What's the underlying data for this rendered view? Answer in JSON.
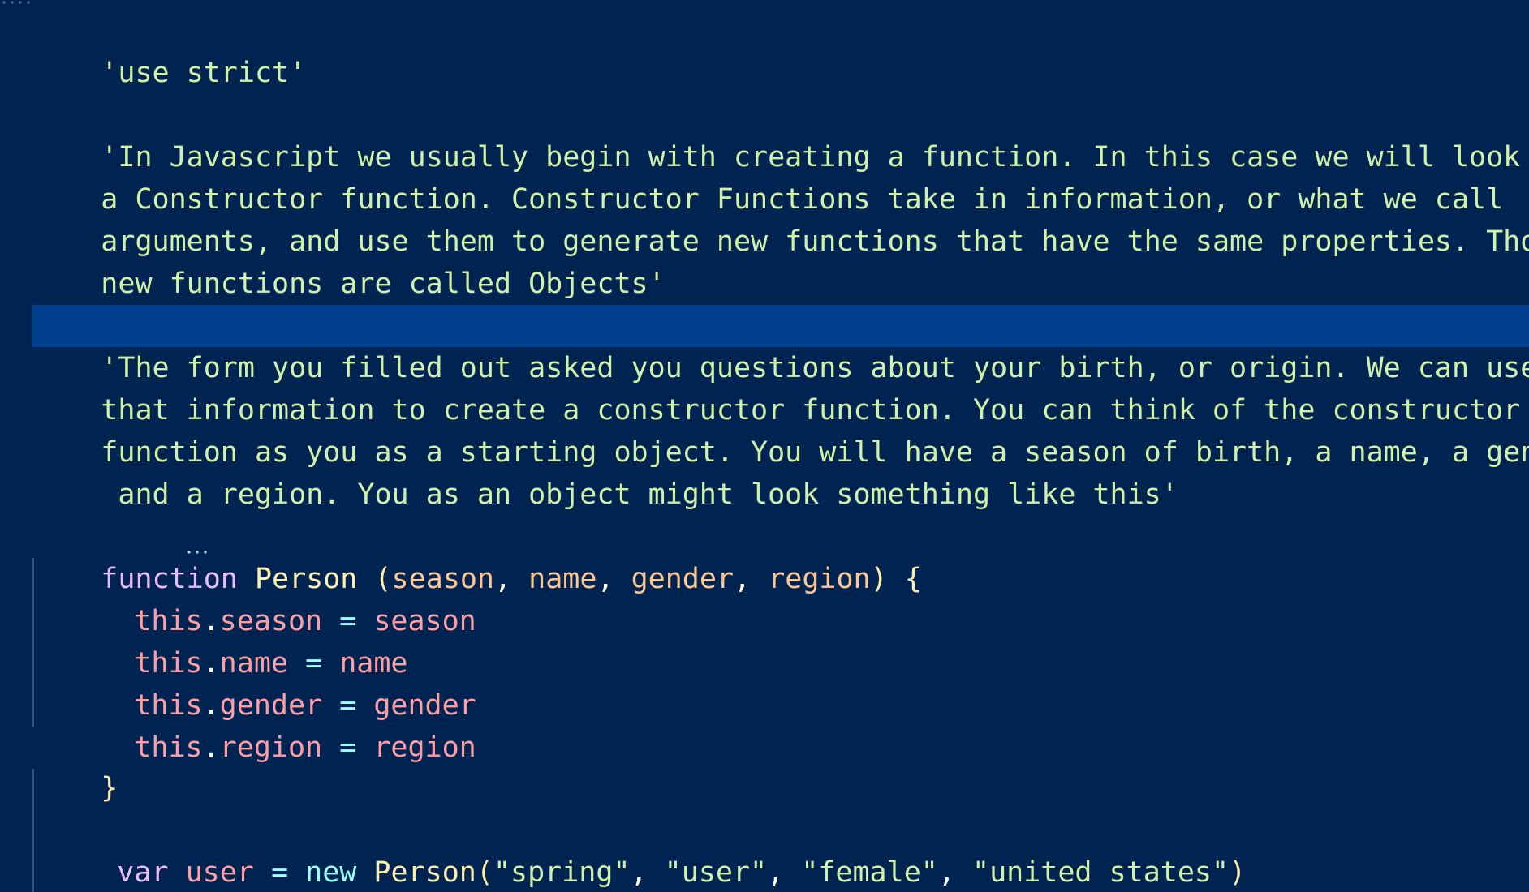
{
  "code": {
    "use_strict": "'use strict'",
    "comment1": [
      "'In Javascript we usually begin with creating a function. In this case we will look at",
      "a Constructor function. Constructor Functions take in information, or what we call",
      "arguments, and use them to generate new functions that have the same properties. Those",
      "new functions are called Objects'"
    ],
    "comment2": [
      "'The form you filled out asked you questions about your birth, or origin. We can use",
      "that information to create a constructor function. You can think of the constructor",
      "function as you as a starting object. You will have a season of birth, a name, a gender,",
      " and a region. You as an object might look something like this'"
    ],
    "func_decl": {
      "keyword": "function",
      "name": "Person",
      "open_paren": " (",
      "params": [
        "season",
        "name",
        "gender",
        "region"
      ],
      "close": ") {"
    },
    "body": [
      {
        "this": "this",
        "prop": "season",
        "eq": " = ",
        "val": "season"
      },
      {
        "this": "this",
        "prop": "name",
        "eq": " = ",
        "val": "name"
      },
      {
        "this": "this",
        "prop": "gender",
        "eq": " = ",
        "val": "gender"
      },
      {
        "this": "this",
        "prop": "region",
        "eq": " = ",
        "val": "region"
      }
    ],
    "close_brace": "}",
    "var_line": {
      "keyword": "var",
      "ident": "user",
      "eq": "=",
      "new_kw": "new",
      "ctor": "Person",
      "open": "(",
      "args": [
        "\"spring\"",
        "\"user\"",
        "\"female\"",
        "\"united states\""
      ],
      "close": ")"
    }
  },
  "colors": {
    "background": "#002451",
    "line_highlight": "#003f8e",
    "string": "#d1f1a9",
    "keyword": "#ebbbff",
    "class_name": "#ffeead",
    "parameter": "#ffc58f",
    "property": "#ff9da4",
    "operator": "#99ffff"
  }
}
